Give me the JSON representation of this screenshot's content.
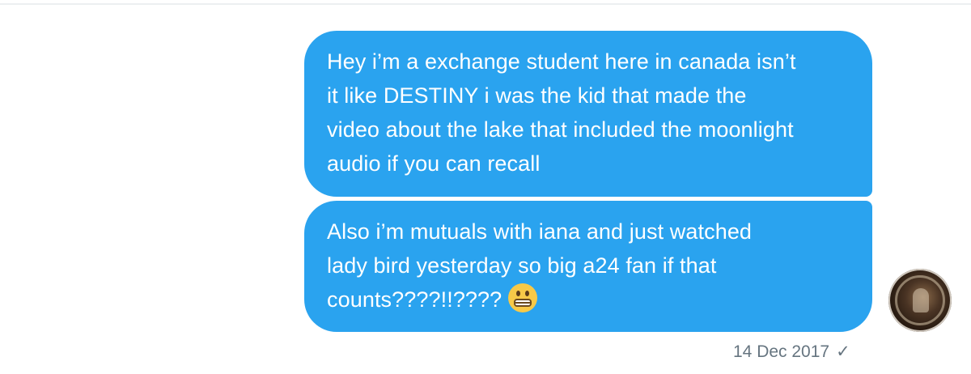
{
  "conversation": {
    "messages": [
      {
        "lines": [
          "Hey i’m a exchange student here in canada isn’t",
          "it like DESTINY i was the kid that made the",
          "video about the lake that included the moonlight",
          "audio if you can recall"
        ]
      },
      {
        "lines": [
          "Also i’m mutuals with iana and just watched",
          "lady bird yesterday so big a24 fan if that",
          "counts????!!????"
        ],
        "emoji": "grimacing-face"
      }
    ],
    "timestamp": "14 Dec 2017",
    "status_icon": "✓"
  },
  "colors": {
    "bubble": "#2aa3ef",
    "bubble_text": "#ffffff",
    "meta_text": "#667580",
    "divider": "#eceff1"
  }
}
